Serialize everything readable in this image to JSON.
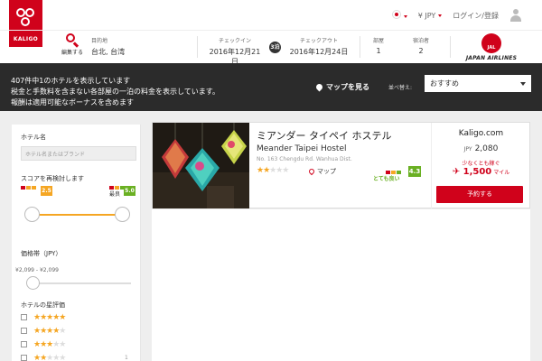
{
  "brand": {
    "name": "KALIGO",
    "accent": "#d0021b"
  },
  "topbar": {
    "currency": "JPY",
    "login": "ログイン/登録"
  },
  "search": {
    "edit_label": "編集する",
    "destination_label": "目的地",
    "destination": "台北, 台湾",
    "checkin_label": "チェックイン",
    "checkin": "2016年12月21日",
    "nights": "3泊",
    "checkout_label": "チェックアウト",
    "checkout": "2016年12月24日",
    "rooms_label": "部屋",
    "rooms": "1",
    "guests_label": "宿泊者",
    "guests": "2",
    "partner_logo_text": "JAL",
    "partner_name": "JAPAN AIRLINES"
  },
  "band": {
    "line1": "407件中1のホテルを表示しています",
    "line2": "税金と手数料を含まない各部屋の一泊の料金を表示しています。",
    "line3": "報酬は適用可能なボーナスを含めます",
    "map_button": "マップを見る",
    "sort_label": "並べ替え:",
    "sort_value": "おすすめ"
  },
  "sidebar": {
    "hotel_name_label": "ホテル名",
    "hotel_name_placeholder": "ホテル名またはブランド",
    "score_label": "スコアを再検討します",
    "score_min": "2.5",
    "score_max_label": "最良",
    "score_max": "5.0",
    "price_label": "価格帯（JPY）",
    "price_range": "¥2,099 - ¥2,099",
    "star_label": "ホテルの星評価",
    "star_rows": [
      {
        "stars": 5,
        "count": ""
      },
      {
        "stars": 4,
        "count": ""
      },
      {
        "stars": 3,
        "count": ""
      },
      {
        "stars": 2,
        "count": "1"
      },
      {
        "stars": 1,
        "count": ""
      }
    ]
  },
  "hotel": {
    "name_ja": "ミアンダー タイペイ ホステル",
    "name_en": "Meander Taipei Hostel",
    "address": "No. 163 Chengdu Rd. Wanhua Dist.",
    "stars": 2,
    "map_link": "マップ",
    "rating_text": "とても良い",
    "rating_score": "4.3",
    "provider": "Kaligo.com",
    "price_currency": "JPY",
    "price": "2,080",
    "earn_label": "少なくとも稼ぐ",
    "miles": "1,500",
    "miles_unit": "マイル",
    "book_button": "予約する"
  }
}
